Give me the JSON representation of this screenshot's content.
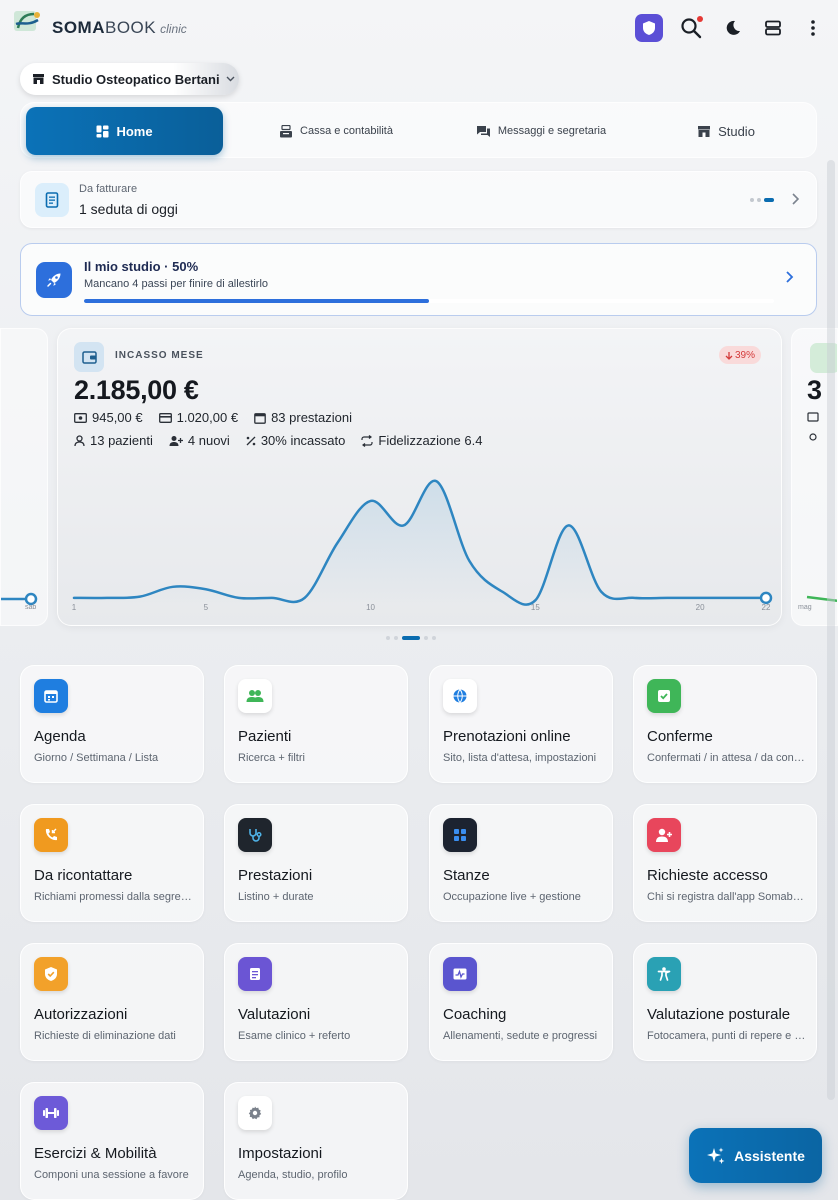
{
  "app": {
    "brand_bold": "SOMA",
    "brand_regular": "BOOK",
    "brand_suffix": "clinic"
  },
  "studio_selector": {
    "label": "Studio Osteopatico Bertani"
  },
  "tabs": [
    {
      "label": "Home",
      "icon": "dashboard-icon",
      "active": true
    },
    {
      "label": "Cassa e contabilità",
      "icon": "cash-register-icon"
    },
    {
      "label": "Messaggi e segretaria",
      "icon": "chat-icon"
    },
    {
      "label": "Studio",
      "icon": "storefront-icon"
    }
  ],
  "invoice_banner": {
    "caption": "Da fatturare",
    "text": "1 seduta di oggi"
  },
  "setup_banner": {
    "title": "Il mio studio · 50%",
    "subtitle": "Mancano 4 passi per finire di allestirlo",
    "progress_percent": 50
  },
  "income_card": {
    "label": "INCASSO MESE",
    "total": "2.185,00 €",
    "change_badge": "39%",
    "change_direction": "down",
    "row1": [
      {
        "icon": "cash-icon",
        "text": "945,00 €"
      },
      {
        "icon": "card-icon",
        "text": "1.020,00 €"
      },
      {
        "icon": "calendar-icon",
        "text": "83 prestazioni"
      }
    ],
    "row2": [
      {
        "icon": "person-icon",
        "text": "13 pazienti"
      },
      {
        "icon": "person-add-icon",
        "text": "4 nuovi"
      },
      {
        "icon": "percent-icon",
        "text": "30% incassato"
      },
      {
        "icon": "repeat-icon",
        "text": "Fidelizzazione 6.4"
      }
    ],
    "peek_left_label": "sab",
    "peek_right_label": "mag",
    "peek_right_value": "3"
  },
  "chart_data": {
    "type": "line",
    "title": "",
    "xlabel": "",
    "ylabel": "",
    "x": [
      1,
      2,
      3,
      4,
      5,
      6,
      7,
      8,
      9,
      10,
      11,
      12,
      13,
      14,
      15,
      16,
      17,
      18,
      19,
      20,
      21,
      22
    ],
    "values": [
      5,
      5,
      6,
      14,
      12,
      5,
      5,
      5,
      50,
      84,
      64,
      100,
      35,
      10,
      3,
      64,
      10,
      5,
      5,
      5,
      5,
      5
    ],
    "xticks": [
      "1",
      "5",
      "10",
      "15",
      "20",
      "22"
    ],
    "ylim": [
      0,
      110
    ],
    "grid": false,
    "color": "#2e86c1"
  },
  "tiles": [
    {
      "title": "Agenda",
      "subtitle": "Giorno / Settimana / Lista",
      "icon": "calendar-icon",
      "color": "#1f7ee0"
    },
    {
      "title": "Pazienti",
      "subtitle": "Ricerca + filtri",
      "icon": "people-icon",
      "color": "#ffffff"
    },
    {
      "title": "Prenotazioni online",
      "subtitle": "Sito, lista d'attesa, impostazioni",
      "icon": "globe-icon",
      "color": "#ffffff"
    },
    {
      "title": "Conferme",
      "subtitle": "Confermati / in attesa / da confermare",
      "icon": "check-icon",
      "color": "#3fb658"
    },
    {
      "title": "Da ricontattare",
      "subtitle": "Richiami promessi dalla segretaria",
      "icon": "phone-callback-icon",
      "color": "#f09a1f"
    },
    {
      "title": "Prestazioni",
      "subtitle": "Listino + durate",
      "icon": "stethoscope-icon",
      "color": "#1f252d"
    },
    {
      "title": "Stanze",
      "subtitle": "Occupazione live + gestione",
      "icon": "rooms-grid-icon",
      "color": "#1c2330"
    },
    {
      "title": "Richieste accesso",
      "subtitle": "Chi si registra dall'app Somabook",
      "icon": "person-add-icon",
      "color": "#e8465c"
    },
    {
      "title": "Autorizzazioni",
      "subtitle": "Richieste di eliminazione dati",
      "icon": "shield-check-icon",
      "color": "#f2a12a"
    },
    {
      "title": "Valutazioni",
      "subtitle": "Esame clinico + referto",
      "icon": "document-icon",
      "color": "#6b55d4"
    },
    {
      "title": "Coaching",
      "subtitle": "Allenamenti, sedute e progressi",
      "icon": "activity-icon",
      "color": "#5a55cf"
    },
    {
      "title": "Valutazione posturale",
      "subtitle": "Fotocamera, punti di repere e analisi",
      "icon": "accessibility-icon",
      "color": "#2aa1b4"
    },
    {
      "title": "Esercizi & Mobilità",
      "subtitle": "Componi una sessione a favore",
      "icon": "dumbbell-icon",
      "color": "#6d5ad8"
    },
    {
      "title": "Impostazioni",
      "subtitle": "Agenda, studio, profilo",
      "icon": "gear-icon",
      "color": "#ffffff"
    }
  ],
  "assistant_button": {
    "label": "Assistente",
    "icon": "sparkles-icon"
  }
}
